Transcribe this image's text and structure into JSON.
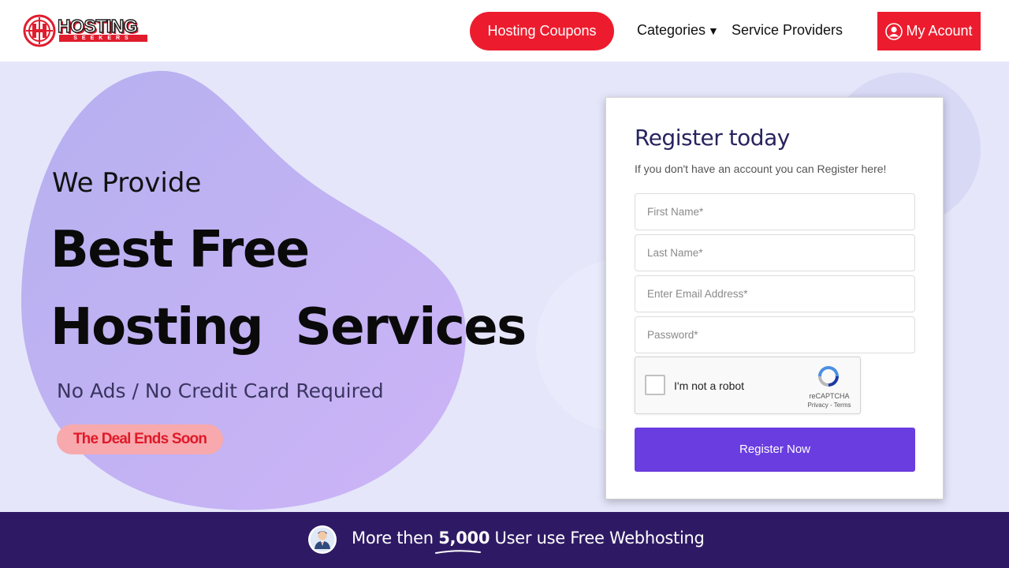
{
  "header": {
    "logo_text": "HOSTING",
    "logo_subtext": "SEEKERS",
    "coupons_button": "Hosting Coupons",
    "categories_link": "Categories",
    "providers_link": "Service Providers",
    "account_button": "My Acount",
    "accent_color": "#ec1c2e"
  },
  "hero": {
    "intro": "We Provide",
    "headline_line1": "Best Free",
    "headline_line2": "Hosting  Services",
    "subline": "No Ads / No Credit Card Required",
    "deal_badge": "The Deal Ends Soon",
    "background_color": "#e5e6fa"
  },
  "register": {
    "title": "Register today",
    "subtitle": "If you don't have an account you can Register here!",
    "first_name_placeholder": "First Name*",
    "last_name_placeholder": "Last Name*",
    "email_placeholder": "Enter Email Address*",
    "password_placeholder": "Password*",
    "captcha_label": "I'm not a robot",
    "captcha_brand": "reCAPTCHA",
    "captcha_links": "Privacy - Terms",
    "submit_button": "Register Now",
    "button_color": "#6a3de0"
  },
  "bottom_bar": {
    "text_before": "More then",
    "number": "5,000",
    "text_after": "User use Free Webhosting",
    "background_color": "#2e1a64",
    "avatar_icon": "user-avatar-icon"
  }
}
